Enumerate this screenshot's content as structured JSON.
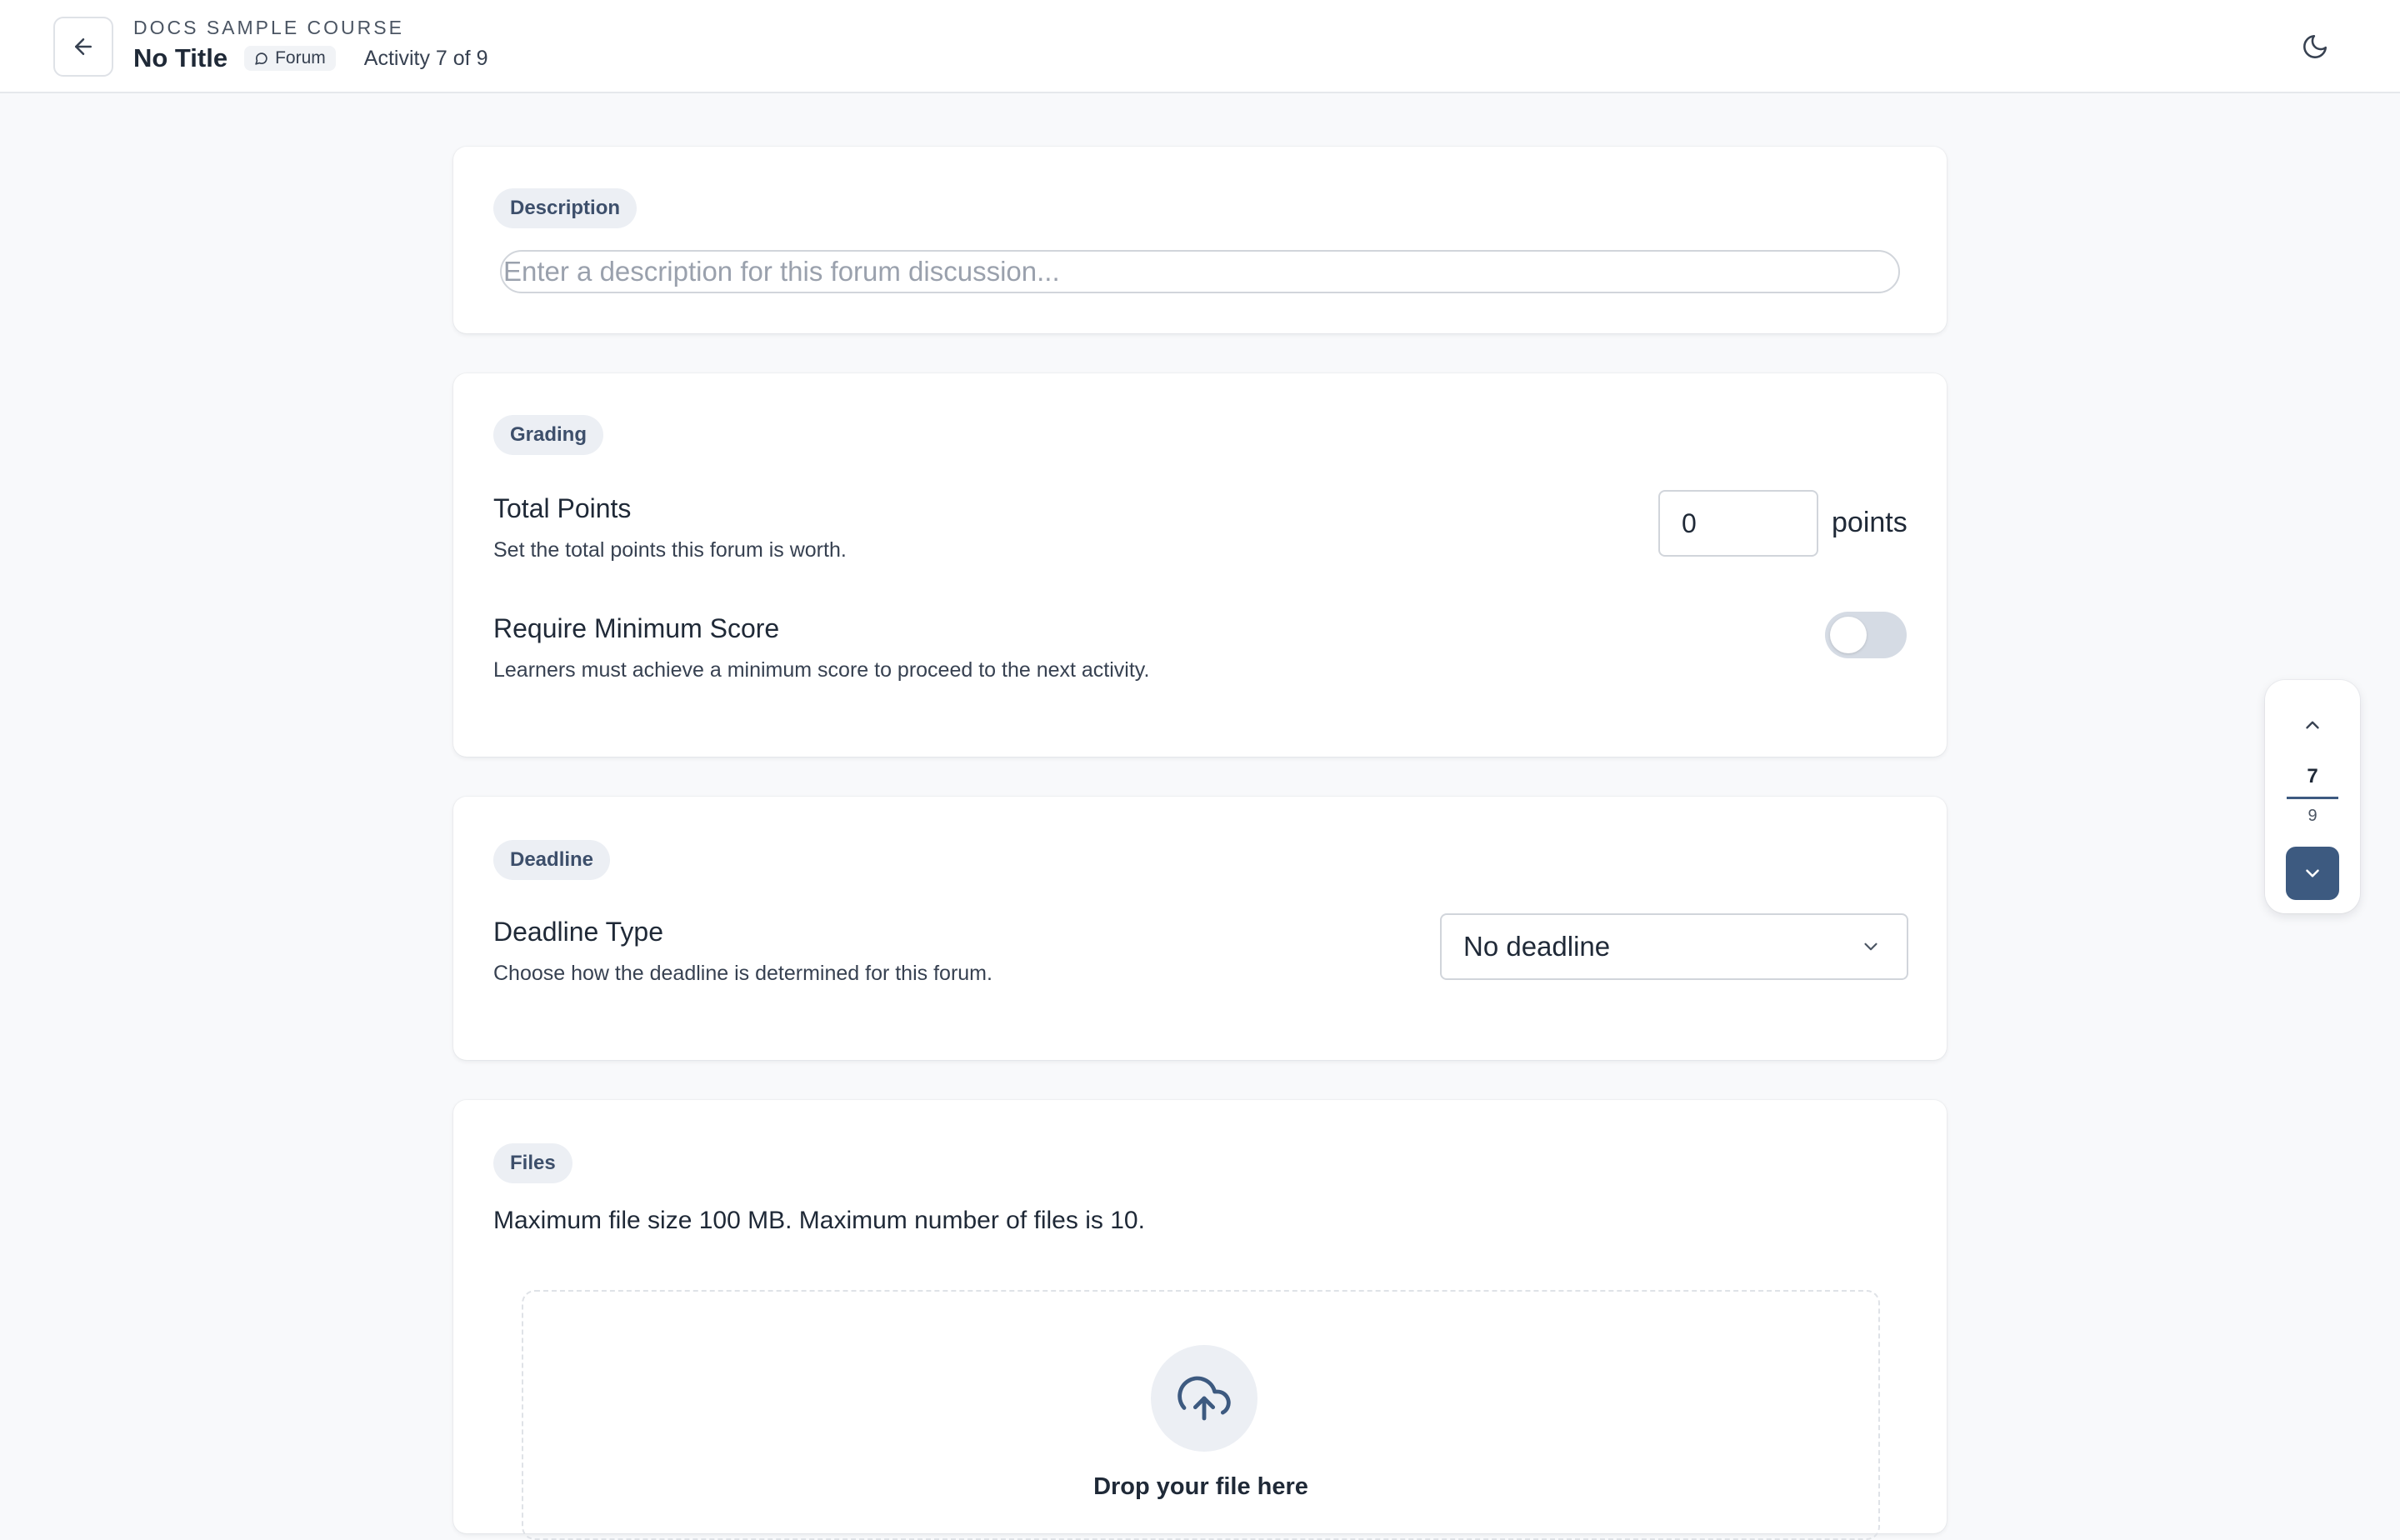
{
  "header": {
    "course_name": "DOCS SAMPLE COURSE",
    "title": "No Title",
    "type_badge": "Forum",
    "activity_count": "Activity 7 of 9",
    "back_icon": "arrow-left-icon",
    "theme_icon": "moon-icon"
  },
  "description": {
    "section_label": "Description",
    "input_value": "",
    "input_placeholder": "Enter a description for this forum discussion..."
  },
  "grading": {
    "section_label": "Grading",
    "total_points": {
      "title": "Total Points",
      "subtitle": "Set the total points this forum is worth.",
      "value": "0",
      "unit": "points"
    },
    "minimum_score": {
      "title": "Require Minimum Score",
      "subtitle": "Learners must achieve a minimum score to proceed to the next activity.",
      "enabled": false
    }
  },
  "deadline": {
    "section_label": "Deadline",
    "title": "Deadline Type",
    "subtitle": "Choose how the deadline is determined for this forum.",
    "selected": "No deadline"
  },
  "files": {
    "section_label": "Files",
    "info": "Maximum file size 100 MB. Maximum number of files is 10.",
    "dropzone_text": "Drop your file here",
    "upload_icon": "cloud-upload-icon"
  },
  "pager": {
    "current": "7",
    "total": "9"
  },
  "colors": {
    "accent": "#3d5a80",
    "pill_bg": "#eceff4",
    "page_bg": "#f8f9fb",
    "toggle_off": "#d5dbe4"
  }
}
